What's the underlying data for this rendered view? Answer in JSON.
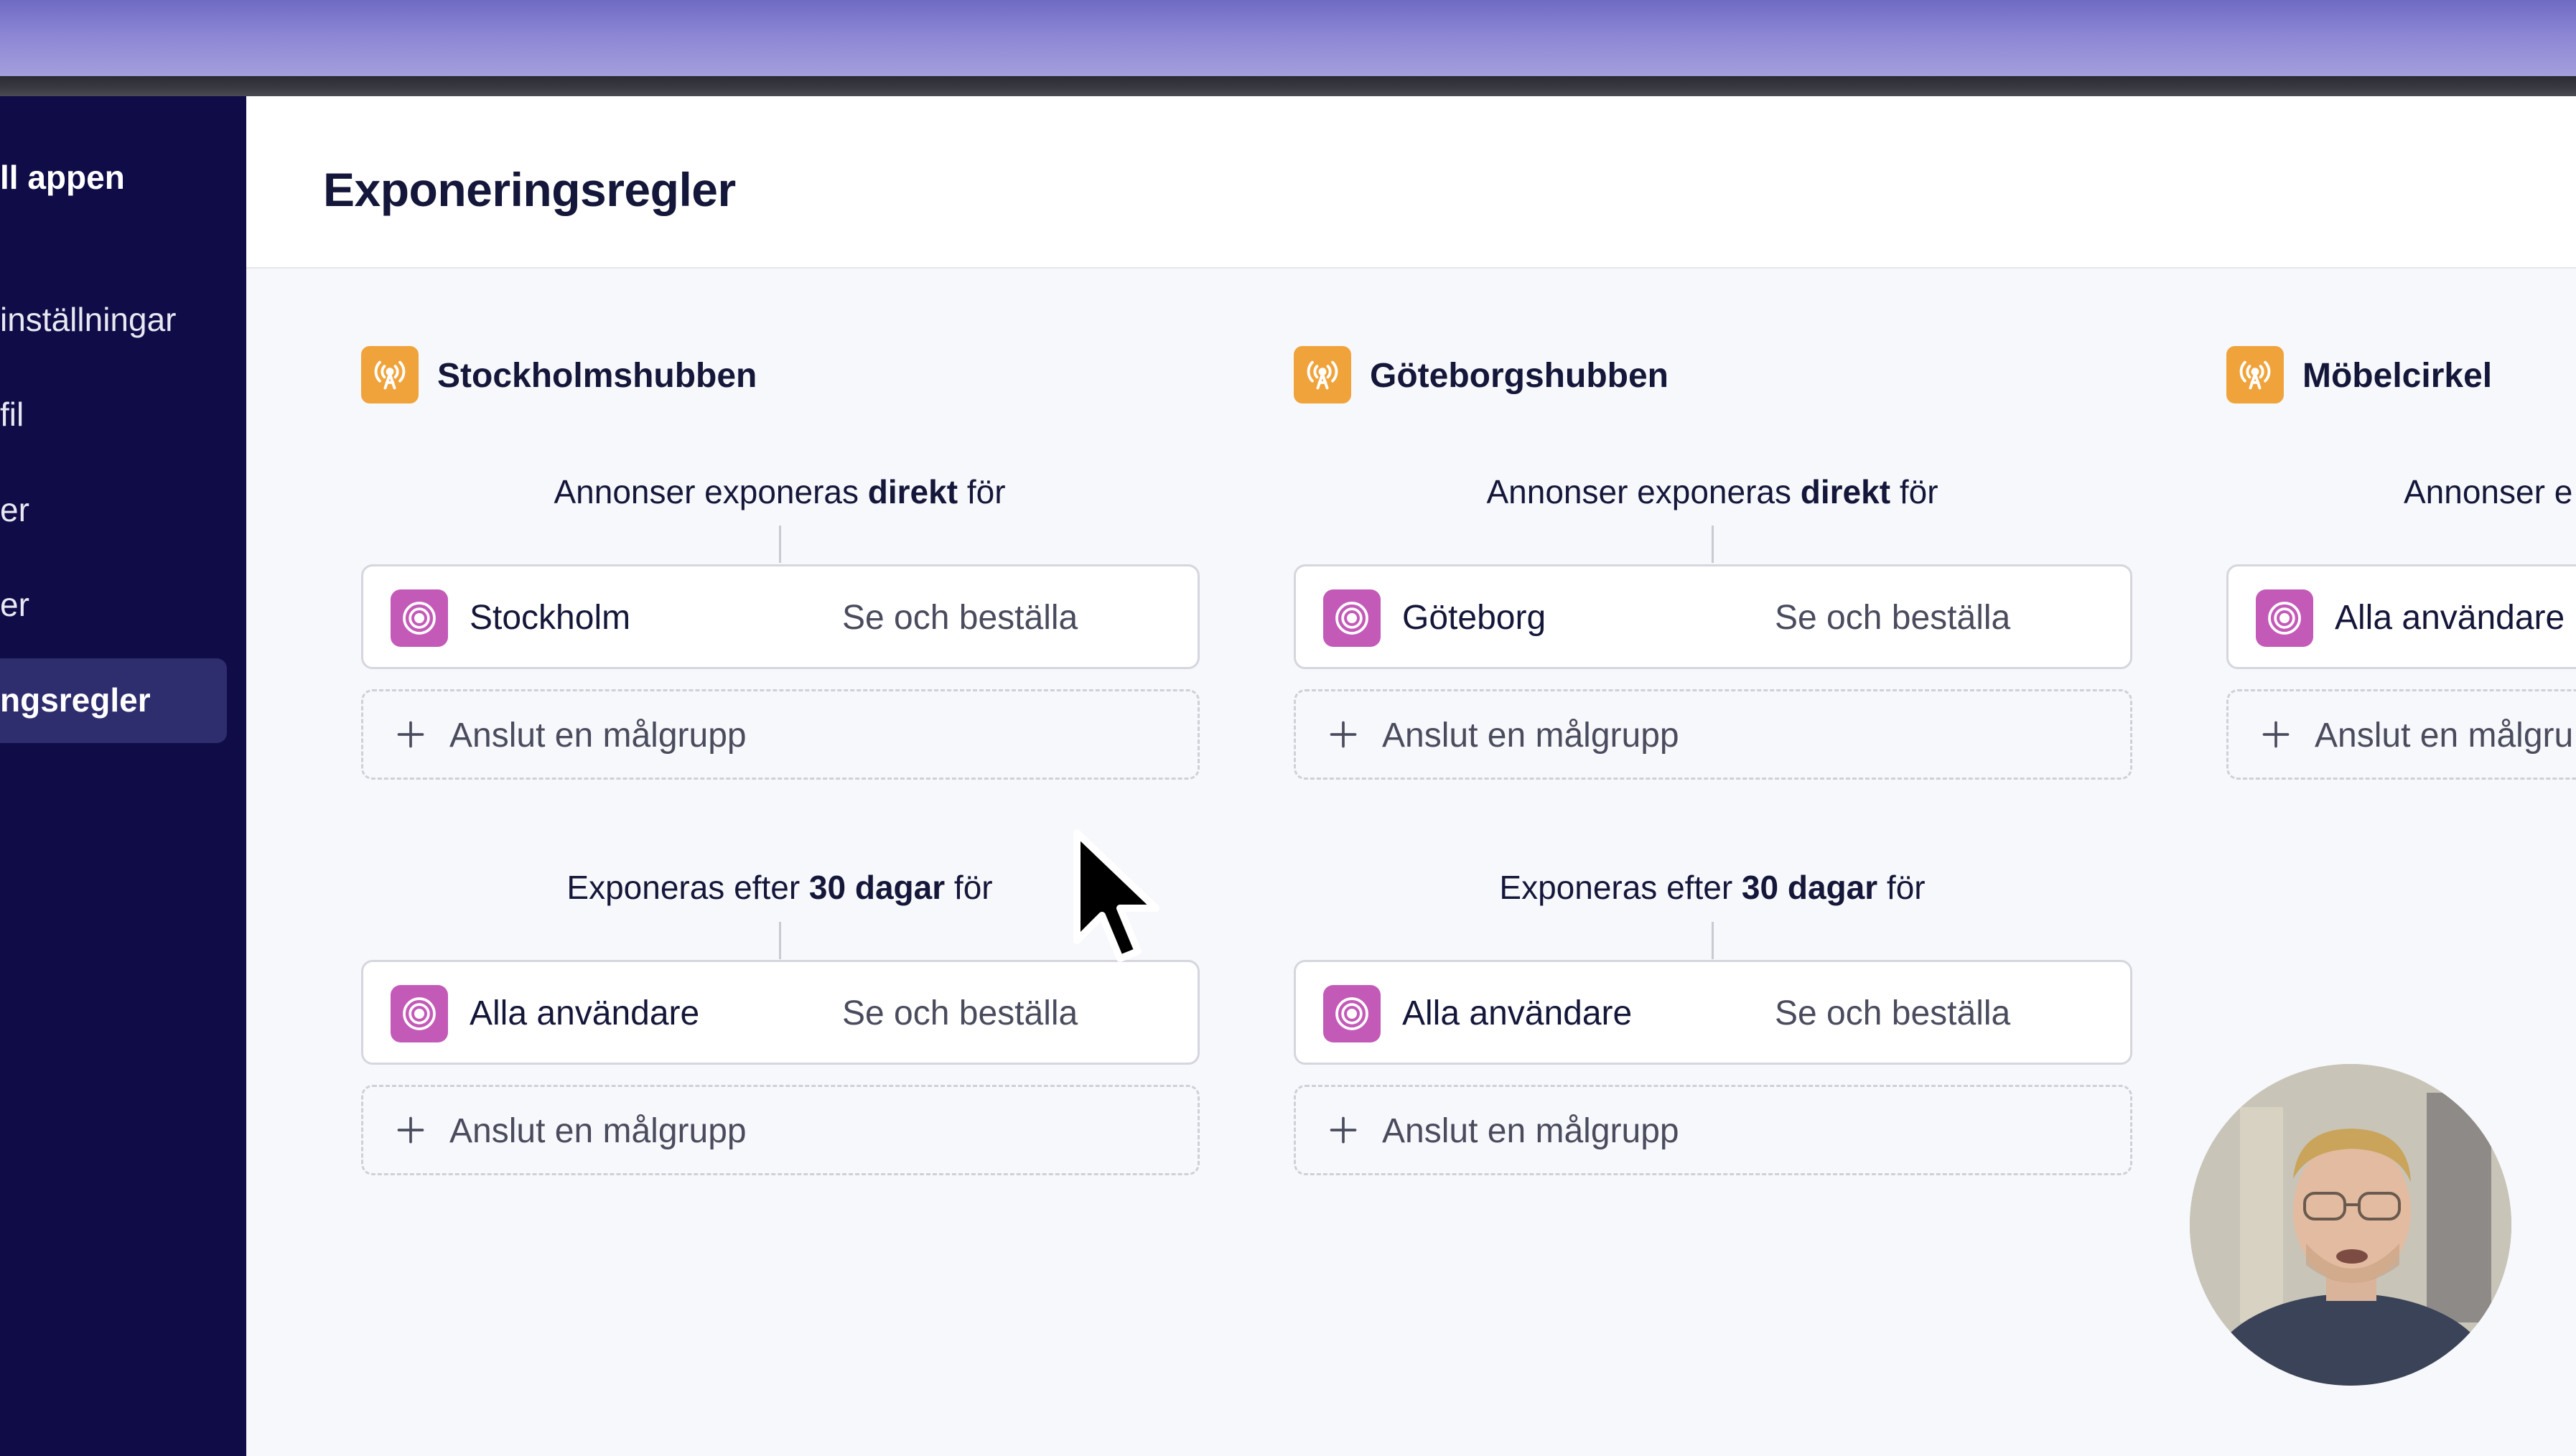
{
  "sidebar": {
    "items": [
      {
        "label": "ll appen"
      },
      {
        "label": "inställningar"
      },
      {
        "label": "fil"
      },
      {
        "label": "er"
      },
      {
        "label": "er"
      },
      {
        "label": "ngsregler"
      }
    ]
  },
  "header": {
    "title": "Exponeringsregler"
  },
  "columns": [
    {
      "title": "Stockholmshubben",
      "rules": [
        {
          "caption_pre": "Annonser exponeras ",
          "caption_bold": "direkt",
          "caption_post": " för",
          "audience": {
            "name": "Stockholm",
            "permission": "Se och beställa"
          },
          "connect_label": "Anslut en målgrupp"
        },
        {
          "caption_pre": "Exponeras efter ",
          "caption_bold": "30 dagar",
          "caption_post": " för",
          "audience": {
            "name": "Alla användare",
            "permission": "Se och beställa"
          },
          "connect_label": "Anslut en målgrupp"
        }
      ]
    },
    {
      "title": "Göteborgshubben",
      "rules": [
        {
          "caption_pre": "Annonser exponeras ",
          "caption_bold": "direkt",
          "caption_post": " för",
          "audience": {
            "name": "Göteborg",
            "permission": "Se och beställa"
          },
          "connect_label": "Anslut en målgrupp"
        },
        {
          "caption_pre": "Exponeras efter ",
          "caption_bold": "30 dagar",
          "caption_post": " för",
          "audience": {
            "name": "Alla användare",
            "permission": "Se och beställa"
          },
          "connect_label": "Anslut en målgrupp"
        }
      ]
    },
    {
      "title": "Möbelcirkel",
      "rules": [
        {
          "caption": "Annonser e",
          "audience": {
            "name": "Alla användare"
          },
          "connect_label": "Anslut en målgru"
        }
      ]
    }
  ],
  "icons": {
    "hub": "broadcast-tower-icon",
    "audience": "target-icon",
    "connect": "plus-icon",
    "cursor": "mouse-pointer-icon"
  },
  "colors": {
    "sidebar_bg": "#0f0c48",
    "hub_icon_bg": "#f0a33b",
    "audience_icon_bg": "#c45ab8"
  }
}
